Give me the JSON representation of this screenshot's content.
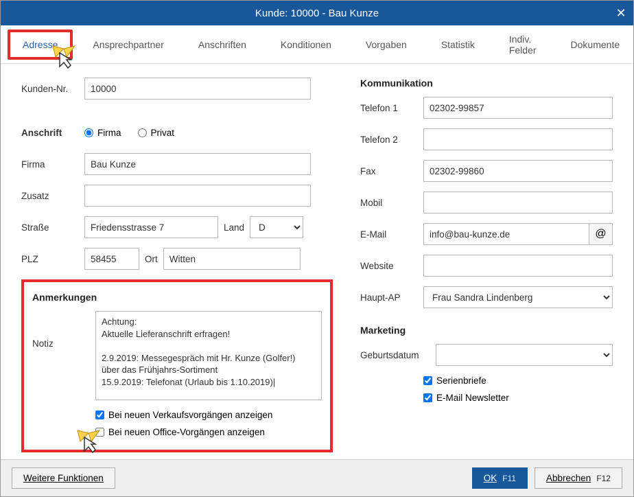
{
  "window": {
    "title": "Kunde: 10000 - Bau Kunze"
  },
  "tabs": {
    "adresse": "Adresse",
    "ansprechpartner": "Ansprechpartner",
    "anschriften": "Anschriften",
    "konditionen": "Konditionen",
    "vorgaben": "Vorgaben",
    "statistik": "Statistik",
    "indiv": "Indiv. Felder",
    "dokumente": "Dokumente"
  },
  "left": {
    "kundennr_label": "Kunden-Nr.",
    "kundennr": "10000",
    "anschrift_label": "Anschrift",
    "radio_firma": "Firma",
    "radio_privat": "Privat",
    "firma_label": "Firma",
    "firma": "Bau Kunze",
    "zusatz_label": "Zusatz",
    "zusatz": "",
    "strasse_label": "Straße",
    "strasse": "Friedensstrasse 7",
    "land_label": "Land",
    "land": "D",
    "plz_label": "PLZ",
    "plz": "58455",
    "ort_label": "Ort",
    "ort": "Witten"
  },
  "anmerkungen": {
    "title": "Anmerkungen",
    "notiz_label": "Notiz",
    "notiz": "Achtung:\nAktuelle Lieferanschrift erfragen!\n\n2.9.2019: Messegespräch mit Hr. Kunze (Golfer!) über das Frühjahrs-Sortiment\n15.9.2019: Telefonat (Urlaub bis 1.10.2019)|",
    "chk_verkauf": "Bei neuen Verkaufsvorgängen anzeigen",
    "chk_office": "Bei neuen Office-Vorgängen anzeigen"
  },
  "komm": {
    "title": "Kommunikation",
    "tel1_label": "Telefon 1",
    "tel1": "02302-99857",
    "tel2_label": "Telefon 2",
    "tel2": "",
    "fax_label": "Fax",
    "fax": "02302-99860",
    "mobil_label": "Mobil",
    "mobil": "",
    "email_label": "E-Mail",
    "email": "info@bau-kunze.de",
    "website_label": "Website",
    "website": "",
    "hauptap_label": "Haupt-AP",
    "hauptap": "Frau Sandra Lindenberg"
  },
  "marketing": {
    "title": "Marketing",
    "geburt_label": "Geburtsdatum",
    "geburt": "",
    "chk_serien": "Serienbriefe",
    "chk_newsletter": "E-Mail Newsletter"
  },
  "footer": {
    "weitere": "Weitere Funktionen",
    "ok": "OK",
    "ok_key": "F11",
    "abbrechen": "Abbrechen",
    "abbrechen_key": "F12"
  }
}
